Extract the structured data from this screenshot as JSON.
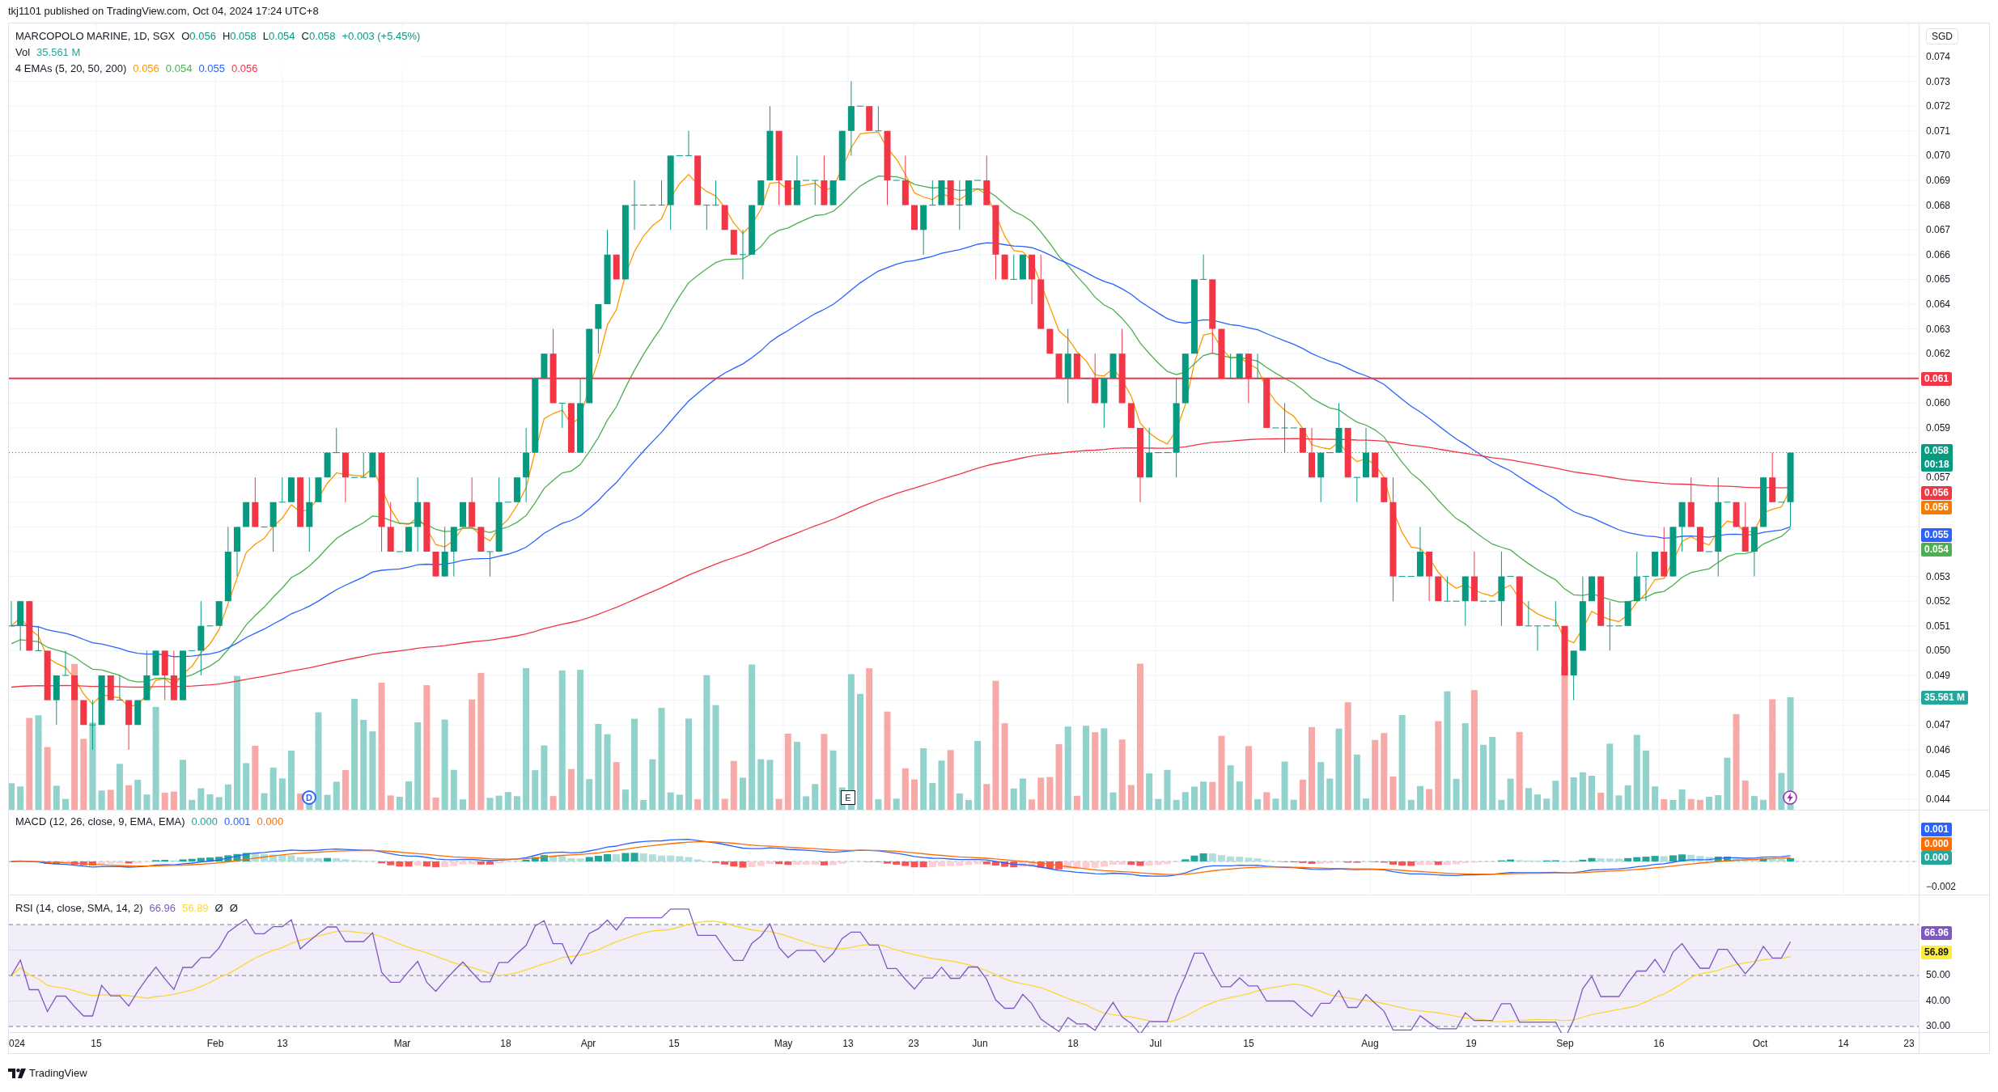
{
  "header": {
    "text": "tkj1101 published on TradingView.com, Oct 04, 2024 17:24 UTC+8"
  },
  "legend": {
    "symbol": "MARCOPOLO MARINE, 1D, SGX",
    "ohlc": [
      {
        "label": "O",
        "value": "0.056"
      },
      {
        "label": "H",
        "value": "0.058"
      },
      {
        "label": "L",
        "value": "0.054"
      },
      {
        "label": "C",
        "value": "0.058"
      }
    ],
    "change": "+0.003 (+5.45%)",
    "volume": {
      "label": "Vol",
      "value": "35.561 M"
    },
    "emas": {
      "label": "4 EMAs (5, 20, 50, 200)",
      "values": [
        {
          "value": "0.056",
          "color": "#ff9800"
        },
        {
          "value": "0.054",
          "color": "#4caf50"
        },
        {
          "value": "0.055",
          "color": "#2962ff"
        },
        {
          "value": "0.056",
          "color": "#f23645"
        }
      ]
    }
  },
  "price_scale": {
    "currency": "SGD",
    "labels": [
      "0.074",
      "0.073",
      "0.072",
      "0.071",
      "0.070",
      "0.069",
      "0.068",
      "0.067",
      "0.066",
      "0.065",
      "0.064",
      "0.063",
      "0.062",
      "0.060",
      "0.059",
      "0.057",
      "0.053",
      "0.052",
      "0.051",
      "0.050",
      "0.049",
      "0.047",
      "0.046",
      "0.045",
      "0.044"
    ],
    "badges": [
      {
        "text": "0.061",
        "color": "#f23645"
      },
      {
        "text": "0.058",
        "subtext": "00:18",
        "color": "#089981"
      },
      {
        "text": "0.056",
        "color": "#f23645"
      },
      {
        "text": "0.056",
        "color": "#f57c00"
      },
      {
        "text": "0.055",
        "color": "#2962ff"
      },
      {
        "text": "0.054",
        "color": "#4caf50"
      },
      {
        "text": "35.561 M",
        "color": "#26a69a"
      }
    ]
  },
  "markers": [
    {
      "kind": "dividend",
      "label": "D"
    },
    {
      "kind": "earnings",
      "label": "E"
    },
    {
      "kind": "flash"
    }
  ],
  "macd": {
    "label": "MACD (12, 26, close, 9, EMA, EMA)",
    "values": [
      {
        "value": "0.000",
        "color": "#26a69a"
      },
      {
        "value": "0.001",
        "color": "#2962ff"
      },
      {
        "value": "0.000",
        "color": "#ff6d00"
      }
    ],
    "scale_labels": [
      "−0.002"
    ],
    "badges": [
      {
        "text": "0.001",
        "color": "#2962ff"
      },
      {
        "text": "0.000",
        "color": "#ff6d00"
      },
      {
        "text": "0.000",
        "color": "#26a69a"
      }
    ]
  },
  "rsi": {
    "label": "RSI (14, close, SMA, 14, 2)",
    "values": [
      {
        "value": "66.96",
        "color": "#7e57c2"
      },
      {
        "value": "56.89",
        "color": "#fdd835"
      }
    ],
    "symbols": [
      "Ø",
      "Ø"
    ],
    "scale_labels": [
      "50.00",
      "40.00",
      "30.00"
    ],
    "badges": [
      {
        "text": "66.96",
        "color": "#7e57c2"
      },
      {
        "text": "56.89",
        "color": "#ffeb3b"
      }
    ]
  },
  "time_axis": {
    "labels": [
      "024",
      "15",
      "Feb",
      "13",
      "Mar",
      "18",
      "Apr",
      "15",
      "May",
      "13",
      "23",
      "Jun",
      "18",
      "Jul",
      "15",
      "Aug",
      "19",
      "Sep",
      "16",
      "Oct",
      "14",
      "23"
    ]
  },
  "footer": {
    "brand": "TradingView"
  }
}
